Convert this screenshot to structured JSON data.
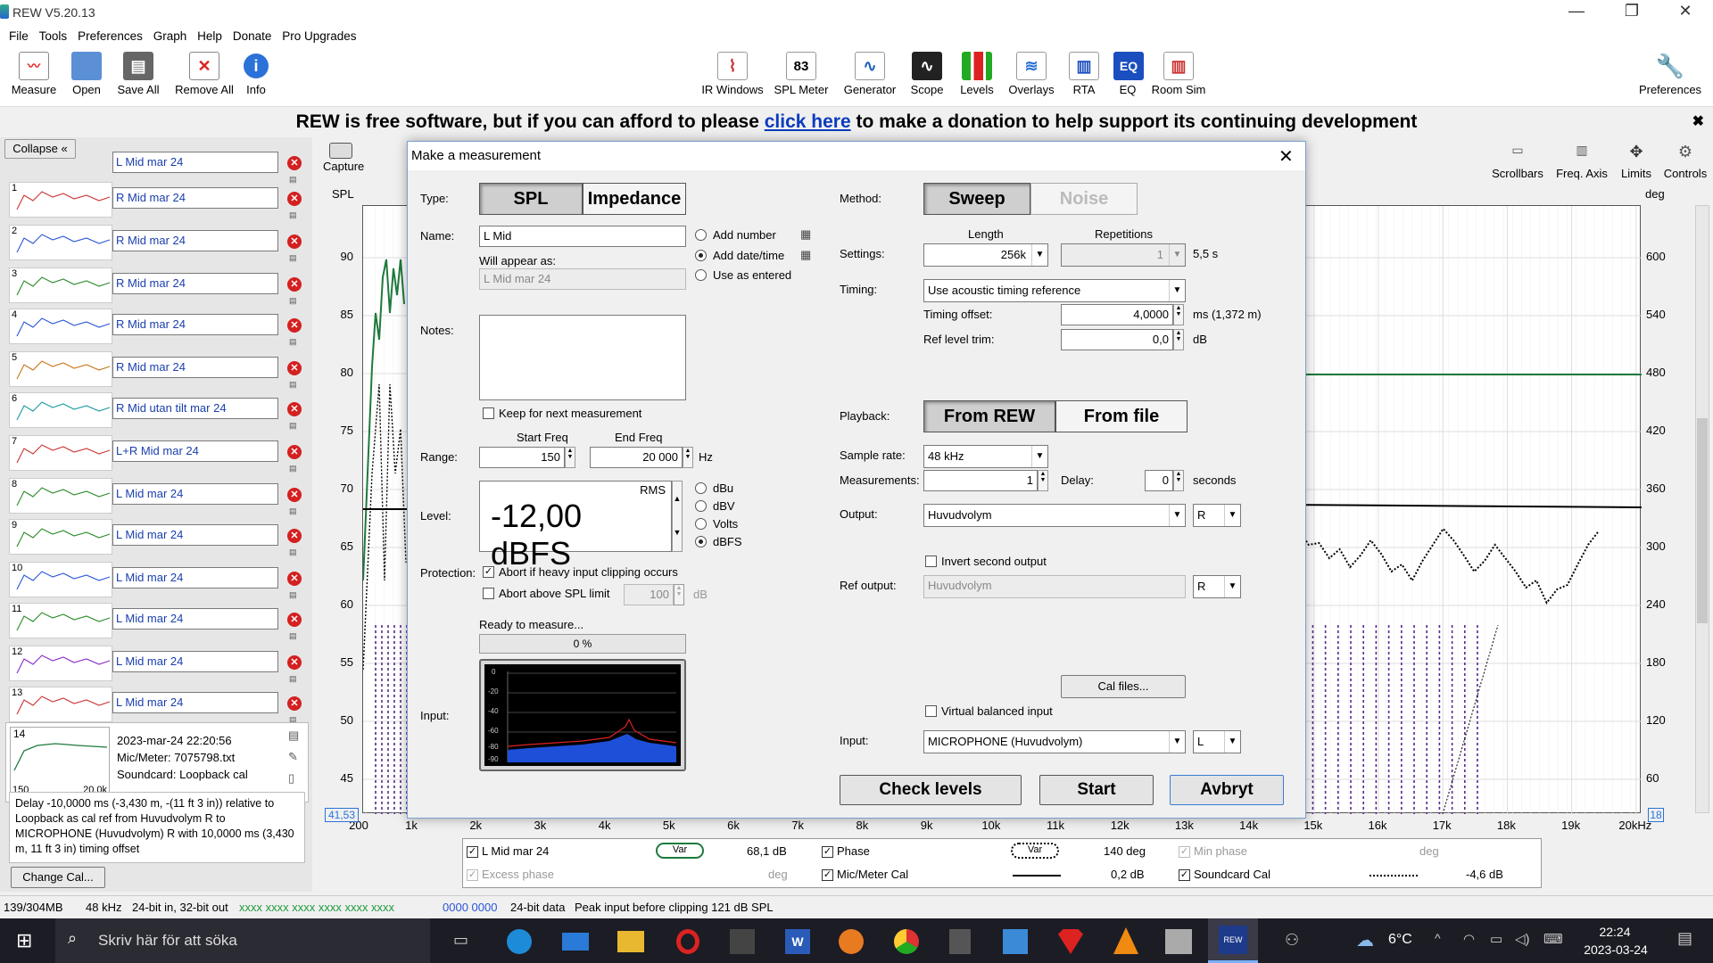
{
  "window": {
    "title": "REW V5.20.13",
    "min_label": "—",
    "max_label": "❐",
    "close_label": "✕"
  },
  "menu": [
    "File",
    "Tools",
    "Preferences",
    "Graph",
    "Help",
    "Donate",
    "Pro Upgrades"
  ],
  "toolbar": {
    "left": [
      {
        "label": "Measure",
        "icon": "measure-icon"
      },
      {
        "label": "Open",
        "icon": "folder-icon"
      },
      {
        "label": "Save All",
        "icon": "save-icon"
      },
      {
        "label": "Remove All",
        "icon": "remove-icon"
      },
      {
        "label": "Info",
        "icon": "info-icon"
      }
    ],
    "center": [
      {
        "label": "IR Windows",
        "icon": "ir-windows-icon"
      },
      {
        "label": "SPL Meter",
        "icon": "spl-meter-icon",
        "badge": "83"
      },
      {
        "label": "Generator",
        "icon": "generator-icon"
      },
      {
        "label": "Scope",
        "icon": "scope-icon"
      },
      {
        "label": "Levels",
        "icon": "levels-icon"
      },
      {
        "label": "Overlays",
        "icon": "overlays-icon"
      },
      {
        "label": "RTA",
        "icon": "rta-icon"
      },
      {
        "label": "EQ",
        "icon": "eq-icon"
      },
      {
        "label": "Room Sim",
        "icon": "room-sim-icon"
      }
    ],
    "right": {
      "label": "Preferences",
      "icon": "wrench-icon"
    }
  },
  "banner": {
    "prefix": "REW is free software, but if you can afford to please ",
    "link": "click here",
    "suffix": " to make a donation to help support its continuing development",
    "close": "✖"
  },
  "left_panel": {
    "collapse_label": "Collapse «",
    "measurements": [
      {
        "num": "",
        "name": "L Mid mar 24"
      },
      {
        "num": "1",
        "name": "R Mid mar 24"
      },
      {
        "num": "2",
        "name": "R Mid mar 24"
      },
      {
        "num": "3",
        "name": "R Mid mar 24"
      },
      {
        "num": "4",
        "name": "R Mid mar 24"
      },
      {
        "num": "5",
        "name": "R Mid mar 24"
      },
      {
        "num": "6",
        "name": "R Mid utan tilt mar 24"
      },
      {
        "num": "7",
        "name": "L+R Mid mar 24"
      },
      {
        "num": "8",
        "name": "L Mid mar 24"
      },
      {
        "num": "9",
        "name": "L Mid mar 24"
      },
      {
        "num": "10",
        "name": "L Mid mar 24"
      },
      {
        "num": "11",
        "name": "L Mid mar 24"
      },
      {
        "num": "12",
        "name": "L Mid mar 24"
      },
      {
        "num": "13",
        "name": "L Mid mar 24"
      }
    ],
    "current": {
      "num": "14",
      "date": "2023-mar-24 22:20:56",
      "mic": "Mic/Meter: 7075798.txt",
      "soundcard": "Soundcard: Loopback cal",
      "thumb_left": "150",
      "thumb_right": "20,0k",
      "note": "Delay -10,0000 ms (-3,430 m, -(11 ft 3 in)) relative to Loopback as cal ref from Huvudvolym R to MICROPHONE (Huvudvolym) R with 10,0000 ms (3,430 m, 11 ft 3 in) timing offset",
      "change_cal": "Change Cal..."
    }
  },
  "graph": {
    "capture_label": "Capture",
    "spl_label": "SPL",
    "deg_label": "deg",
    "deg_label_right": "deg",
    "controls": [
      "Scrollbars",
      "Freq. Axis",
      "Limits",
      "Controls"
    ],
    "y_left": [
      "90",
      "85",
      "80",
      "75",
      "70",
      "65",
      "60",
      "55",
      "50",
      "45"
    ],
    "y_right": [
      "600",
      "540",
      "480",
      "420",
      "360",
      "300",
      "240",
      "180",
      "120",
      "60"
    ],
    "x_ticks": [
      "200",
      "1k",
      "2k",
      "3k",
      "4k",
      "5k",
      "6k",
      "7k",
      "8k",
      "9k",
      "10k",
      "11k",
      "12k",
      "13k",
      "14k",
      "15k",
      "16k",
      "17k",
      "18k",
      "19k",
      "20kHz"
    ],
    "y_min_box": "41,53",
    "y_right_min_box": "18"
  },
  "legend": {
    "row1": [
      {
        "label": "L Mid mar 24",
        "checked": true,
        "value": "68,1 dB",
        "var": "Var"
      },
      {
        "label": "Phase",
        "checked": true,
        "value": "140 deg",
        "var": "Var"
      },
      {
        "label": "Min phase",
        "checked": true,
        "disabled": true,
        "value": "deg"
      }
    ],
    "row2": [
      {
        "label": "Excess phase",
        "checked": true,
        "disabled": true,
        "value": "deg"
      },
      {
        "label": "Mic/Meter Cal",
        "checked": true,
        "value": "0,2 dB"
      },
      {
        "label": "Soundcard Cal",
        "checked": true,
        "value": "-4,6 dB"
      }
    ]
  },
  "dialog": {
    "title": "Make a measurement",
    "type_label": "Type:",
    "type_options": [
      "SPL",
      "Impedance"
    ],
    "name_label": "Name:",
    "name_value": "L Mid",
    "will_appear_label": "Will appear as:",
    "will_appear_value": "L Mid mar 24",
    "name_options": [
      "Add number",
      "Add date/time",
      "Use as entered"
    ],
    "notes_label": "Notes:",
    "keep_label": "Keep for next measurement",
    "range_label": "Range:",
    "start_freq_label": "Start Freq",
    "start_freq": "150",
    "end_freq_label": "End Freq",
    "end_freq": "20 000",
    "hz": "Hz",
    "level_label": "Level:",
    "rms": "RMS",
    "level_value": "-12,00 dBFS",
    "level_units": [
      "dBu",
      "dBV",
      "Volts",
      "dBFS"
    ],
    "protection_label": "Protection:",
    "abort_clip": "Abort if heavy input clipping occurs",
    "abort_spl": "Abort above SPL limit",
    "spl_limit": "100",
    "db": "dB",
    "ready": "Ready to measure...",
    "progress": "0 %",
    "input_label": "Input:",
    "meter_ticks": [
      "0",
      "-20",
      "-40",
      "-60",
      "-80",
      "-90"
    ],
    "method_label": "Method:",
    "method_options": [
      "Sweep",
      "Noise"
    ],
    "length_label": "Length",
    "repetitions_label": "Repetitions",
    "settings_label": "Settings:",
    "length_value": "256k",
    "repetitions_value": "1",
    "duration": "5,5 s",
    "timing_label": "Timing:",
    "timing_value": "Use acoustic timing reference",
    "timing_offset_label": "Timing offset:",
    "timing_offset": "4,0000",
    "timing_offset_unit": "ms (1,372 m)",
    "ref_trim_label": "Ref level trim:",
    "ref_trim": "0,0",
    "ref_trim_unit": "dB",
    "playback_label": "Playback:",
    "playback_options": [
      "From REW",
      "From file"
    ],
    "sample_rate_label": "Sample rate:",
    "sample_rate": "48 kHz",
    "measurements_label": "Measurements:",
    "measurements_value": "1",
    "delay_label": "Delay:",
    "delay_value": "0",
    "seconds": "seconds",
    "output_label": "Output:",
    "output_value": "Huvudvolym",
    "output_channel": "R",
    "invert_label": "Invert second output",
    "ref_output_label": "Ref output:",
    "ref_output_value": "Huvudvolym",
    "ref_output_channel": "R",
    "cal_files": "Cal files...",
    "virtual_balanced": "Virtual balanced input",
    "input_device_label": "Input:",
    "input_device": "MICROPHONE (Huvudvolym)",
    "input_channel": "L",
    "check_levels": "Check levels",
    "start": "Start",
    "cancel": "Avbryt"
  },
  "status": {
    "memory": "139/304MB",
    "rate": "48 kHz",
    "bits": "24-bit in, 32-bit out",
    "in_ind": "xxxx xxxx  xxxx xxxx  xxxx xxxx",
    "out_ind": "0000 0000",
    "data": "24-bit data",
    "peak": "Peak input before clipping 121 dB SPL"
  },
  "taskbar": {
    "search": "Skriv här för att söka",
    "weather": "6°C",
    "time": "22:24",
    "date": "2023-03-24"
  },
  "colors": {
    "accent_link": "#0b3bbf",
    "curve_main": "#1e7a3c",
    "delete": "#d42020"
  }
}
